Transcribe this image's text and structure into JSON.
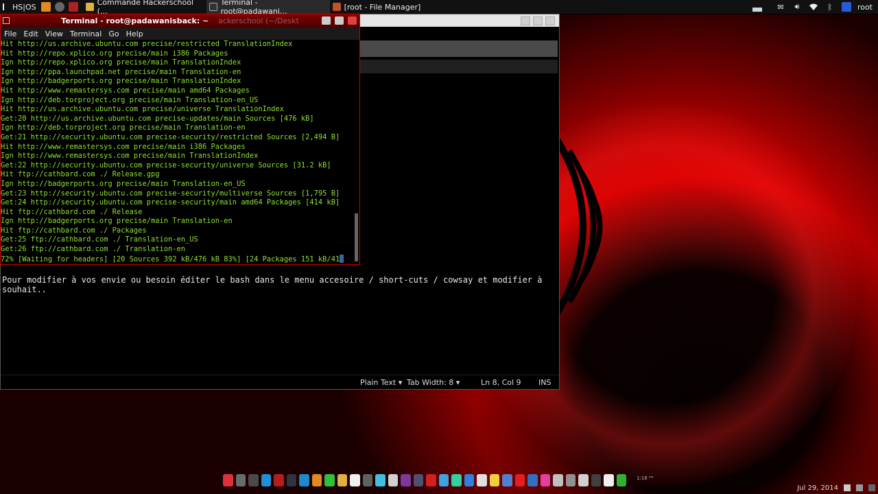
{
  "top_panel": {
    "os_label": "HS|OS",
    "tasks": [
      {
        "label": "Commande Hackerschool (…",
        "icon": "folder-icon"
      },
      {
        "label": "Terminal - root@padawani…",
        "icon": "terminal-icon"
      },
      {
        "label": "[root - File Manager]",
        "icon": "file-manager-icon"
      }
    ],
    "user": "root",
    "tray_icons": [
      "mail-icon",
      "volume-icon",
      "wifi-icon",
      "bluetooth-icon",
      "network-icon"
    ]
  },
  "terminal": {
    "title": "Terminal - root@padawanisback: ~",
    "title_ghost": "ackerschool (~/Deskt",
    "menu": [
      "File",
      "Edit",
      "View",
      "Terminal",
      "Go",
      "Help"
    ],
    "lines": [
      "Hit http://us.archive.ubuntu.com precise/restricted TranslationIndex",
      "Hit http://repo.xplico.org precise/main i386 Packages",
      "Ign http://repo.xplico.org precise/main TranslationIndex",
      "Ign http://ppa.launchpad.net precise/main Translation-en",
      "Ign http://badgerports.org precise/main TranslationIndex",
      "Hit http://www.remastersys.com precise/main amd64 Packages",
      "Ign http://deb.torproject.org precise/main Translation-en_US",
      "Hit http://us.archive.ubuntu.com precise/universe TranslationIndex",
      "Get:20 http://us.archive.ubuntu.com precise-updates/main Sources [476 kB]",
      "Ign http://deb.torproject.org precise/main Translation-en",
      "Get:21 http://security.ubuntu.com precise-security/restricted Sources [2,494 B]",
      "Hit http://www.remastersys.com precise/main i386 Packages",
      "Ign http://www.remastersys.com precise/main TranslationIndex",
      "Get:22 http://security.ubuntu.com precise-security/universe Sources [31.2 kB]",
      "Hit ftp://cathbard.com ./ Release.gpg",
      "Ign http://badgerports.org precise/main Translation-en_US",
      "Get:23 http://security.ubuntu.com precise-security/multiverse Sources [1,795 B]",
      "Get:24 http://security.ubuntu.com precise-security/main amd64 Packages [414 kB]",
      "Hit ftp://cathbard.com ./ Release",
      "Ign http://badgerports.org precise/main Translation-en",
      "Hit ftp://cathbard.com ./ Packages",
      "Get:25 ftp://cathbard.com ./ Translation-en_US",
      "Get:26 ftp://cathbard.com ./ Translation-en"
    ],
    "progress_line": "72% [Waiting for headers] [20 Sources 392 kB/476 kB 83%] [24 Packages 151 kB/41"
  },
  "editor": {
    "text": "Pour modifier à vos envie ou besoin éditer le bash dans le menu accesoire / short-cuts / cowsay et modifier à souhait..",
    "status": {
      "syntax": "Plain Text",
      "tab_width": "Tab Width:  8",
      "position": "Ln 8, Col 9",
      "mode": "INS"
    }
  },
  "dock": {
    "small_clock": "1:16 ᴾᴹ",
    "icons": [
      {
        "name": "hackerschool-icon",
        "color": "#e0303a"
      },
      {
        "name": "settings-icon",
        "color": "#6a6a6a"
      },
      {
        "name": "package-icon",
        "color": "#4a4a4a"
      },
      {
        "name": "skype-icon",
        "color": "#1e90d6"
      },
      {
        "name": "terminal-red-icon",
        "color": "#b02020"
      },
      {
        "name": "terminal-icon",
        "color": "#2e3440"
      },
      {
        "name": "text-editor-icon",
        "color": "#1e88d0"
      },
      {
        "name": "archive-icon",
        "color": "#e08a20"
      },
      {
        "name": "chat-icon",
        "color": "#30c040"
      },
      {
        "name": "folder-icon",
        "color": "#e0b040"
      },
      {
        "name": "calendar-icon",
        "color": "#f0f0f0"
      },
      {
        "name": "chart-icon",
        "color": "#606060"
      },
      {
        "name": "colors-icon",
        "color": "#40c0e0"
      },
      {
        "name": "pen-icon",
        "color": "#d0d0d0"
      },
      {
        "name": "tor-icon",
        "color": "#7a3aa0"
      },
      {
        "name": "wireshark-icon",
        "color": "#505070"
      },
      {
        "name": "bug-icon",
        "color": "#d02020"
      },
      {
        "name": "fish-icon",
        "color": "#40a0e0"
      },
      {
        "name": "metasploit-icon",
        "color": "#30d0a0"
      },
      {
        "name": "network-icon",
        "color": "#3080e0"
      },
      {
        "name": "disk-icon",
        "color": "#e0e0e0"
      },
      {
        "name": "document-icon",
        "color": "#f0d040"
      },
      {
        "name": "usb-icon",
        "color": "#5080d0"
      },
      {
        "name": "opera-icon",
        "color": "#e02020"
      },
      {
        "name": "keepass-icon",
        "color": "#3070c0"
      },
      {
        "name": "image-icon",
        "color": "#e040a0"
      },
      {
        "name": "tools-icon",
        "color": "#c0c0c0"
      },
      {
        "name": "wifi-scan-icon",
        "color": "#909090"
      },
      {
        "name": "magnifier-icon",
        "color": "#d0d0d0"
      },
      {
        "name": "window-icon",
        "color": "#404040"
      },
      {
        "name": "notes-icon",
        "color": "#f0f0f0"
      },
      {
        "name": "globe-icon",
        "color": "#30b030"
      }
    ]
  },
  "bottom_tray": {
    "date": "Jul 29, 2014"
  }
}
